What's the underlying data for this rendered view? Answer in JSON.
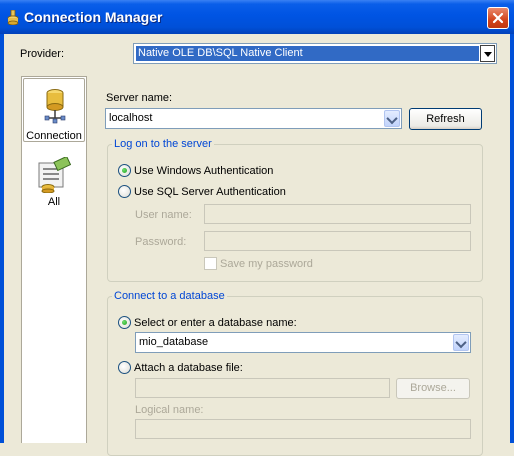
{
  "window": {
    "title": "Connection Manager",
    "title_icon": "datasource-icon",
    "close_icon": "close-icon"
  },
  "provider": {
    "label": "Provider:",
    "value": "Native OLE DB\\SQL Native Client"
  },
  "nav": {
    "items": [
      {
        "label": "Connection",
        "icon": "database-icon",
        "selected": true
      },
      {
        "label": "All",
        "icon": "properties-icon",
        "selected": false
      }
    ]
  },
  "server": {
    "label": "Server name:",
    "value": "localhost",
    "refresh_label": "Refresh"
  },
  "logon": {
    "title": "Log on to the server",
    "windows_auth_label": "Use Windows Authentication",
    "windows_auth_checked": true,
    "sql_auth_label": "Use SQL Server Authentication",
    "sql_auth_checked": false,
    "user_label": "User name:",
    "user_value": "",
    "password_label": "Password:",
    "password_value": "",
    "save_password_label": "Save my password",
    "save_password_checked": false
  },
  "database": {
    "title": "Connect to a database",
    "select_label": "Select or enter a database name:",
    "select_checked": true,
    "db_value": "mio_database",
    "attach_label": "Attach a database file:",
    "attach_checked": false,
    "attach_value": "",
    "browse_label": "Browse...",
    "logical_label": "Logical name:",
    "logical_value": ""
  },
  "colors": {
    "titlebar": "#0054e3",
    "dialog_bg": "#ece9d8",
    "group_title": "#0046d5",
    "selection": "#316ac5"
  }
}
